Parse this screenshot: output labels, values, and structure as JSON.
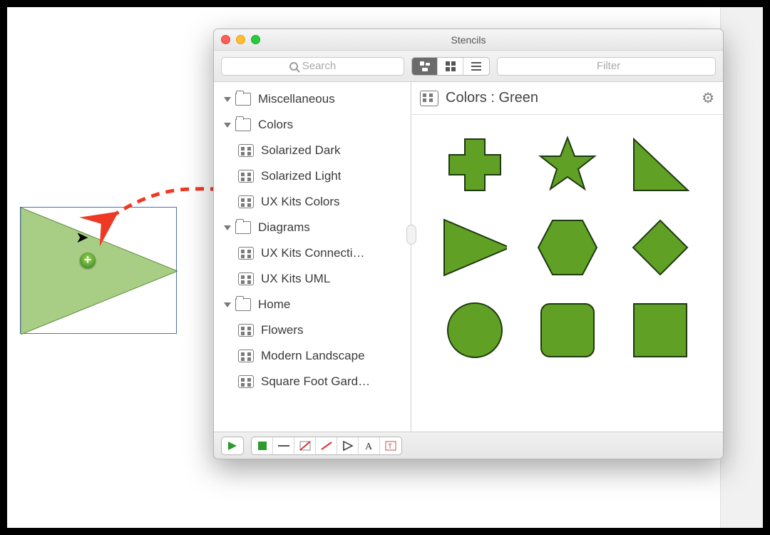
{
  "window": {
    "title": "Stencils"
  },
  "toolbar": {
    "search_placeholder": "Search",
    "filter_placeholder": "Filter"
  },
  "tree": {
    "groups": [
      {
        "label": "Miscellaneous",
        "children": []
      },
      {
        "label": "Colors",
        "children": [
          {
            "label": "Solarized Dark"
          },
          {
            "label": "Solarized Light"
          },
          {
            "label": "UX Kits Colors"
          }
        ]
      },
      {
        "label": "Diagrams",
        "children": [
          {
            "label": "UX Kits Connecti…"
          },
          {
            "label": "UX Kits UML"
          }
        ]
      },
      {
        "label": "Home",
        "children": [
          {
            "label": "Flowers"
          },
          {
            "label": "Modern Landscape"
          },
          {
            "label": "Square Foot Gard…"
          }
        ]
      }
    ]
  },
  "content": {
    "title": "Colors : Green",
    "shapes": [
      "plus",
      "star",
      "right-triangle",
      "triangle",
      "hexagon",
      "diamond",
      "circle",
      "rounded-square",
      "square"
    ]
  },
  "colors": {
    "shape_fill": "#5fa025",
    "shape_stroke": "#1e3a10",
    "drag_arrow": "#ee3a24"
  }
}
